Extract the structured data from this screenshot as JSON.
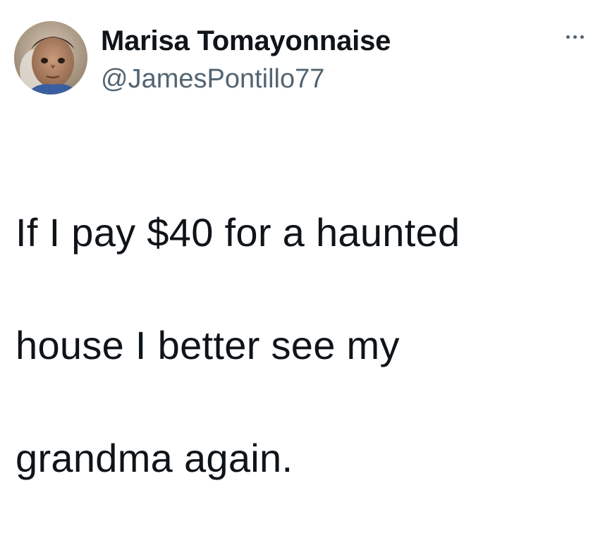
{
  "tweet": {
    "author": {
      "display_name": "Marisa Tomayonnaise",
      "handle": "@JamesPontillo77"
    },
    "text_lines": [
      "If I pay $40 for a haunted",
      "house I better see my",
      "grandma again."
    ],
    "more_icon": "more-horizontal-icon"
  },
  "colors": {
    "background": "#ffffff",
    "primary_text": "#0f1419",
    "secondary_text": "#536471"
  }
}
